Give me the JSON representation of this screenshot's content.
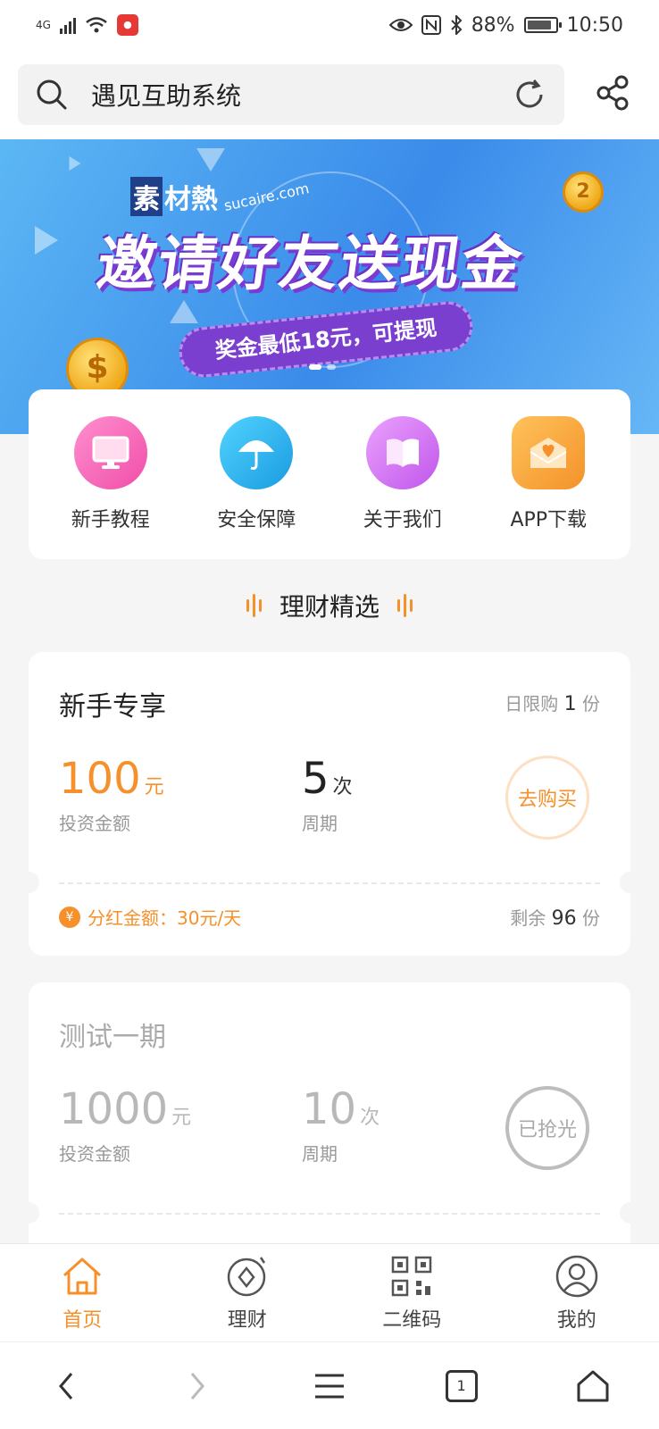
{
  "status": {
    "network": "4G",
    "battery": "88%",
    "battery_level": 0.88,
    "time": "10:50"
  },
  "search": {
    "query": "遇见互助系统"
  },
  "banner": {
    "watermark_box": "素",
    "watermark_text": "材熱",
    "watermark_domain": "sucaire.com",
    "title": "邀请好友送现金",
    "subtitle": "奖金最低18元，可提现",
    "coin_left": "$",
    "coin_right": "2"
  },
  "quick": [
    {
      "label": "新手教程",
      "icon": "monitor-icon",
      "color": "#f45fb6"
    },
    {
      "label": "安全保障",
      "icon": "umbrella-icon",
      "color": "#22b1ec"
    },
    {
      "label": "关于我们",
      "icon": "book-icon",
      "color": "#d66ef2"
    },
    {
      "label": "APP下载",
      "icon": "envelope-heart-icon",
      "color": "#f7a634"
    }
  ],
  "section_title": "理财精选",
  "products": [
    {
      "name": "新手专享",
      "limit_prefix": "日限购",
      "limit_count": "1",
      "limit_suffix": "份",
      "amount": "100",
      "amount_unit": "元",
      "amount_label": "投资金额",
      "period": "5",
      "period_unit": "次",
      "period_label": "周期",
      "action": "去购买",
      "dividend_icon": "¥",
      "dividend": "分红金额：30元/天",
      "remain_prefix": "剩余",
      "remain_count": "96",
      "remain_suffix": "份"
    },
    {
      "name": "测试一期",
      "amount": "1000",
      "amount_unit": "元",
      "amount_label": "投资金额",
      "period": "10",
      "period_unit": "次",
      "period_label": "周期",
      "action": "已抢光"
    }
  ],
  "tabs": [
    {
      "label": "首页",
      "icon": "home-icon",
      "active": true
    },
    {
      "label": "理财",
      "icon": "finance-icon",
      "active": false
    },
    {
      "label": "二维码",
      "icon": "qr-code-icon",
      "active": false
    },
    {
      "label": "我的",
      "icon": "user-icon",
      "active": false
    }
  ],
  "browser": {
    "tab_count": "1"
  },
  "colors": {
    "accent": "#f5902a",
    "banner_blue": "#3a8bea",
    "banner_purple": "#7b3fd0"
  }
}
